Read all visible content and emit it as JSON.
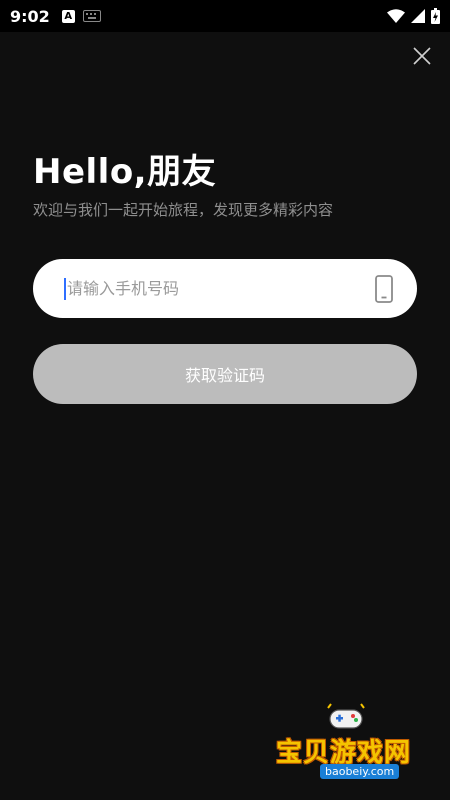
{
  "status_bar": {
    "time": "9:02",
    "notification_icons": [
      "android-a-icon",
      "keyboard-icon"
    ],
    "system_icons": [
      "wifi-icon",
      "signal-icon",
      "battery-charging-icon"
    ]
  },
  "header": {
    "close_icon": "close-icon"
  },
  "greeting": {
    "title": "Hello,朋友",
    "subtitle": "欢迎与我们一起开始旅程，发现更多精彩内容"
  },
  "phone_field": {
    "placeholder": "请输入手机号码",
    "value": "",
    "icon": "smartphone-icon"
  },
  "get_code_button": {
    "label": "获取验证码"
  },
  "watermark": {
    "text": "宝贝游戏网",
    "url": "baobeiy.com"
  },
  "colors": {
    "background": "#0f0f0f",
    "input_background": "#ffffff",
    "button_disabled": "#bcbcbc",
    "subtitle": "#8f8f8f",
    "cursor": "#2f6fff"
  }
}
